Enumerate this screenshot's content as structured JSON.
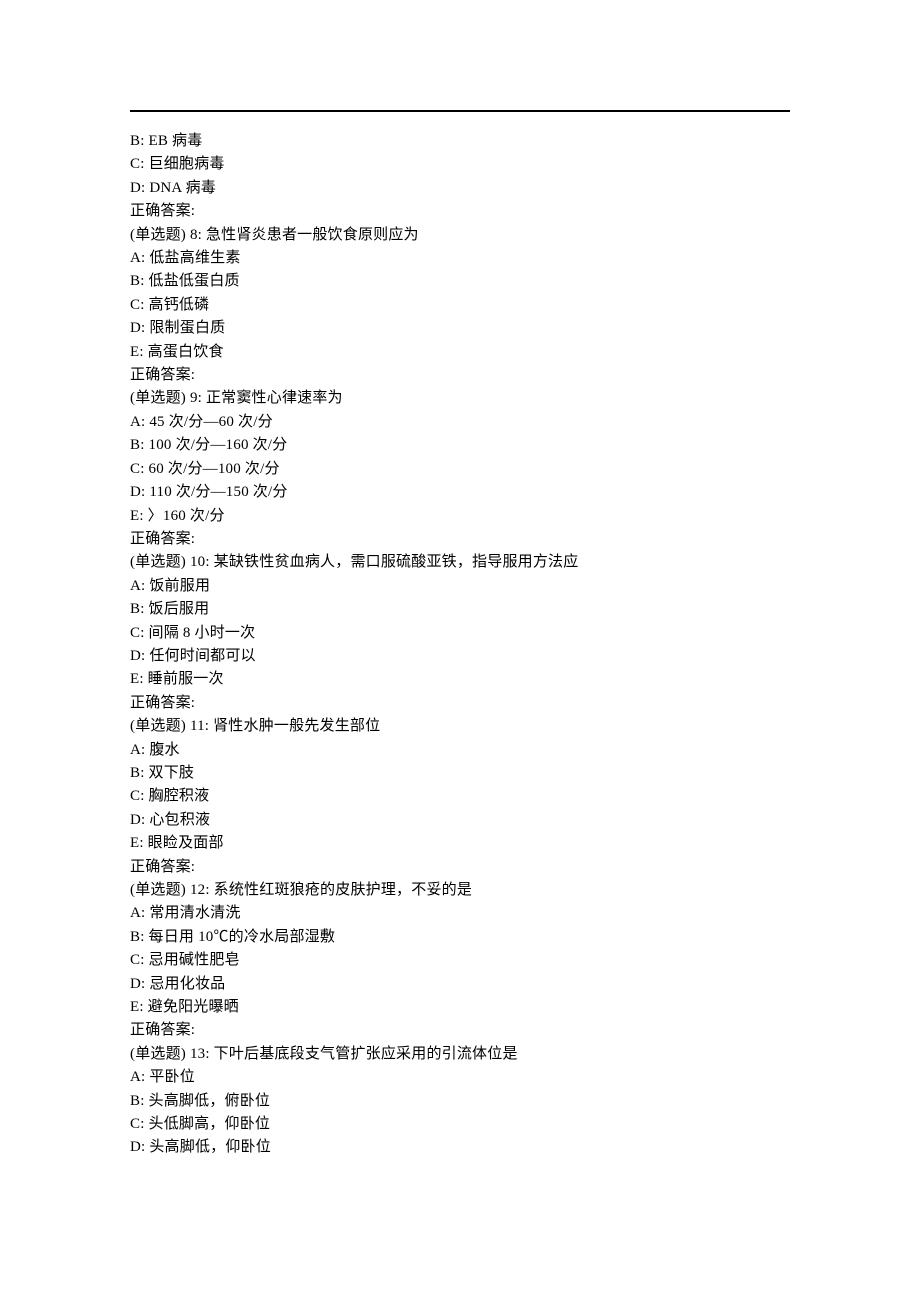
{
  "lines": {
    "l0": "B: EB 病毒",
    "l1": "C: 巨细胞病毒",
    "l2": "D: DNA 病毒",
    "l3": "正确答案:",
    "l4": "(单选题) 8: 急性肾炎患者一般饮食原则应为",
    "l5": "A: 低盐高维生素",
    "l6": "B: 低盐低蛋白质",
    "l7": "C: 高钙低磷",
    "l8": "D: 限制蛋白质",
    "l9": "E: 高蛋白饮食",
    "l10": "正确答案:",
    "l11": "(单选题) 9: 正常窦性心律速率为",
    "l12": "A: 45 次/分—60 次/分",
    "l13": "B: 100 次/分—160 次/分",
    "l14": "C: 60 次/分—100 次/分",
    "l15": "D: 110 次/分—150 次/分",
    "l16": "E: 〉160 次/分",
    "l17": "正确答案:",
    "l18": "(单选题) 10: 某缺铁性贫血病人，需口服硫酸亚铁，指导服用方法应",
    "l19": "A: 饭前服用",
    "l20": "B: 饭后服用",
    "l21": "C: 间隔 8 小时一次",
    "l22": "D: 任何时间都可以",
    "l23": "E: 睡前服一次",
    "l24": "正确答案:",
    "l25": "(单选题) 11: 肾性水肿一般先发生部位",
    "l26": "A: 腹水",
    "l27": "B: 双下肢",
    "l28": "C: 胸腔积液",
    "l29": "D: 心包积液",
    "l30": "E: 眼睑及面部",
    "l31": "正确答案:",
    "l32": "(单选题) 12: 系统性红斑狼疮的皮肤护理，不妥的是",
    "l33": "A: 常用清水清洗",
    "l34": "B: 每日用 10℃的冷水局部湿敷",
    "l35": "C: 忌用碱性肥皂",
    "l36": "D: 忌用化妆品",
    "l37": "E: 避免阳光曝晒",
    "l38": "正确答案:",
    "l39": "(单选题) 13: 下叶后基底段支气管扩张应采用的引流体位是",
    "l40": "A: 平卧位",
    "l41": "B: 头高脚低，俯卧位",
    "l42": "C: 头低脚高，仰卧位",
    "l43": "D: 头高脚低，仰卧位"
  }
}
